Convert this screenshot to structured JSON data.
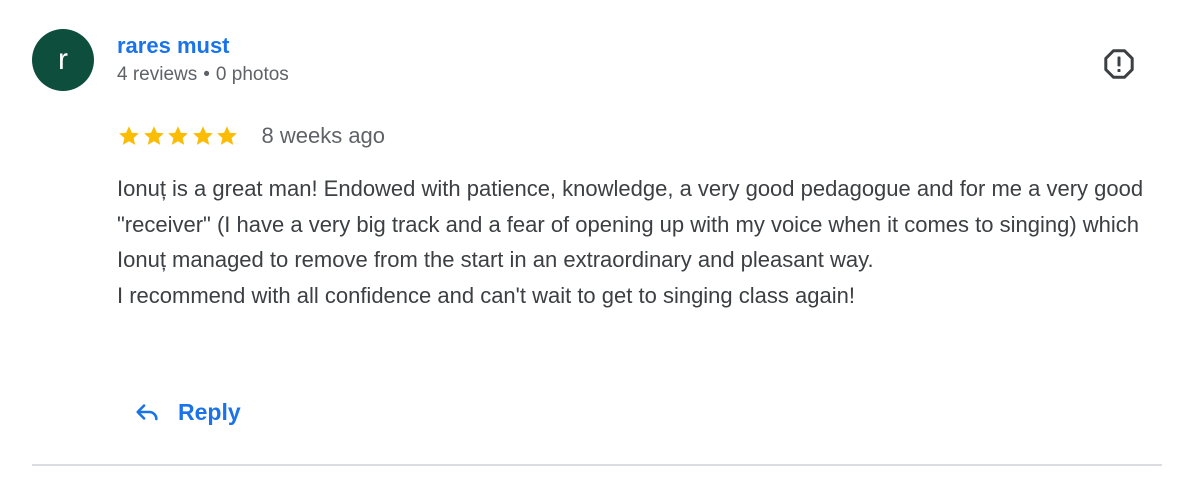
{
  "review": {
    "author": {
      "initial": "r",
      "name": "rares must",
      "reviews_count": "4 reviews",
      "separator": "•",
      "photos_count": "0 photos",
      "avatar_color": "#0d4f3c"
    },
    "rating": {
      "stars": 5,
      "max": 5,
      "star_color": "#fbbc04"
    },
    "date": "8 weeks ago",
    "text": {
      "paragraph_1": "Ionuț is a great man! Endowed with patience, knowledge, a very good pedagogue and for me a very good \"receiver\" (I have a very big track and a fear of opening up with my voice when it comes to singing) which Ionuț managed to remove from the start in an extraordinary and pleasant way.",
      "paragraph_2": "I recommend with all confidence and can't wait to get to singing class again!"
    },
    "actions": {
      "reply_label": "Reply",
      "reply_icon": "reply-arrow-icon",
      "flag_icon": "report-octagon-icon"
    },
    "colors": {
      "link": "#1a73e8",
      "secondary_text": "#5f6368",
      "body_text": "#3c4043",
      "divider": "#dadce0"
    }
  }
}
